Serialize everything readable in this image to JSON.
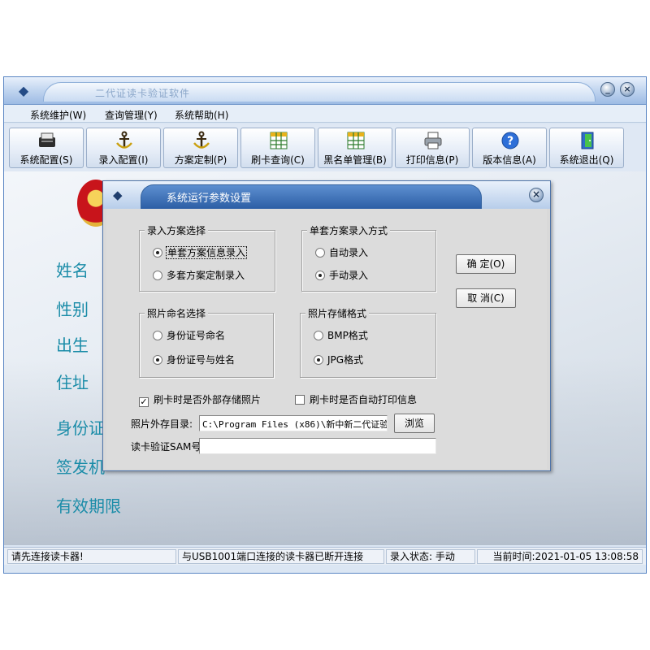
{
  "window": {
    "title": "二代证读卡验证软件"
  },
  "menu": {
    "system": "系统维护(W)",
    "query": "查询管理(Y)",
    "help": "系统帮助(H)"
  },
  "toolbar": {
    "items": [
      {
        "label": "系统配置(S)",
        "icon": "card-reader-icon"
      },
      {
        "label": "录入配置(I)",
        "icon": "anchor-icon"
      },
      {
        "label": "方案定制(P)",
        "icon": "anchor-icon"
      },
      {
        "label": "刷卡查询(C)",
        "icon": "table-icon"
      },
      {
        "label": "黑名单管理(B)",
        "icon": "table-icon"
      },
      {
        "label": "打印信息(P)",
        "icon": "printer-icon"
      },
      {
        "label": "版本信息(A)",
        "icon": "help-icon"
      },
      {
        "label": "系统退出(Q)",
        "icon": "exit-icon"
      }
    ]
  },
  "fields": {
    "name": "姓名",
    "gender": "性别",
    "birth": "出生",
    "address": "住址",
    "id_number": "身份证",
    "issuer": "签发机",
    "validity": "有效期限"
  },
  "status": {
    "message": "请先连接读卡器!",
    "port": "与USB1001端口连接的读卡器已断开连接",
    "input_state": "录入状态: 手动",
    "time": "当前时间:2021-01-05 13:08:58"
  },
  "dialog": {
    "title": "系统运行参数设置",
    "entry_scheme": {
      "title": "录入方案选择",
      "options": [
        "单套方案信息录入",
        "多套方案定制录入"
      ],
      "selected": 0
    },
    "single_mode": {
      "title": "单套方案录入方式",
      "options": [
        "自动录入",
        "手动录入"
      ],
      "selected": 1
    },
    "photo_naming": {
      "title": "照片命名选择",
      "options": [
        "身份证号命名",
        "身份证号与姓名"
      ],
      "selected": 1
    },
    "photo_format": {
      "title": "照片存储格式",
      "options": [
        "BMP格式",
        "JPG格式"
      ],
      "selected": 1
    },
    "ok_label": "确 定(O)",
    "cancel_label": "取 消(C)",
    "save_photo_label": "刷卡时是否外部存储照片",
    "save_photo_checked": true,
    "auto_print_label": "刷卡时是否自动打印信息",
    "auto_print_checked": false,
    "photo_dir_label": "照片外存目录:",
    "photo_dir_value": "C:\\Program Files (x86)\\新中新二代证验",
    "browse_label": "浏览",
    "sam_label": "读卡验证SAM号",
    "sam_value": ""
  }
}
